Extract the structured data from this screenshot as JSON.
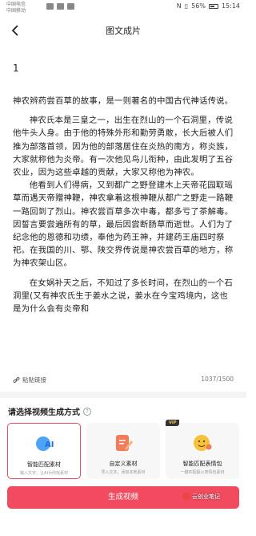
{
  "status": {
    "carrier_1": "中国电信",
    "carrier_2": "中国移动",
    "battery": "56%",
    "time": "15:14"
  },
  "header": {
    "title": "图文成片",
    "back_icon": "chevron-left-icon"
  },
  "editor": {
    "first_line": "1",
    "paragraphs": [
      "神农辨药尝百草的故事，是一则著名的中国古代神话传说。",
      "神农氏本是三皇之一，出生在烈山的一个石洞里，传说他牛头人身。由于他的特殊外形和勤劳勇敢，长大后被人们推为部落首领，因为他的部落居住在炎热的南方，称炎族，大家就称他为炎帝。有一次他见鸟儿衔种，由此发明了五谷农业，因为这些卓越的贡献，大家又称他为神农。",
      "他看到人们得病，又到都广之野登建木上天帝花园取瑶草而遇天帝赠神鞭，神农拿着这根神鞭从都广之野走一路鞭一路回到了烈山。神农尝百草多次中毒，都多亏了茶解毒。因誓言要尝遍所有的草，最后因尝断肠草而逝世。人们为了纪念他的恩德和功绩，奉他为药王神，并建药王庙四时祭祀。在我国的川、鄂、陕交界传说是神农尝百草的地方，称为神农架山区。",
      "在女娲补天之后，不知过了多长时间，在烈山的一个石洞里(又有神农氏生于姜水之说，姜水在今宝鸡境内，这也是为什么会有炎帝和"
    ],
    "attach_label": "粘贴链接",
    "attach_icon": "link-icon",
    "counter": "1037/1500"
  },
  "method": {
    "title": "请选择视频生成方式",
    "help_icon": "question-circle-icon",
    "cards": [
      {
        "label": "智能匹配素材",
        "desc": "输入文字，让AI为你找素材",
        "icon": "ai-head-icon",
        "selected": true
      },
      {
        "label": "自定义素材",
        "desc": "导入文本，添加本地素材",
        "icon": "edit-document-icon",
        "selected": false
      },
      {
        "label": "智能匹配表情包",
        "desc": "一键匹配超火表情包素材",
        "icon": "emoji-face-icon",
        "selected": false,
        "badge": "VIP"
      }
    ]
  },
  "generate_button": "生成视频",
  "watermark": "云创业笔记",
  "colors": {
    "accent": "#f24a5e",
    "selected_border": "#f04a5a"
  }
}
